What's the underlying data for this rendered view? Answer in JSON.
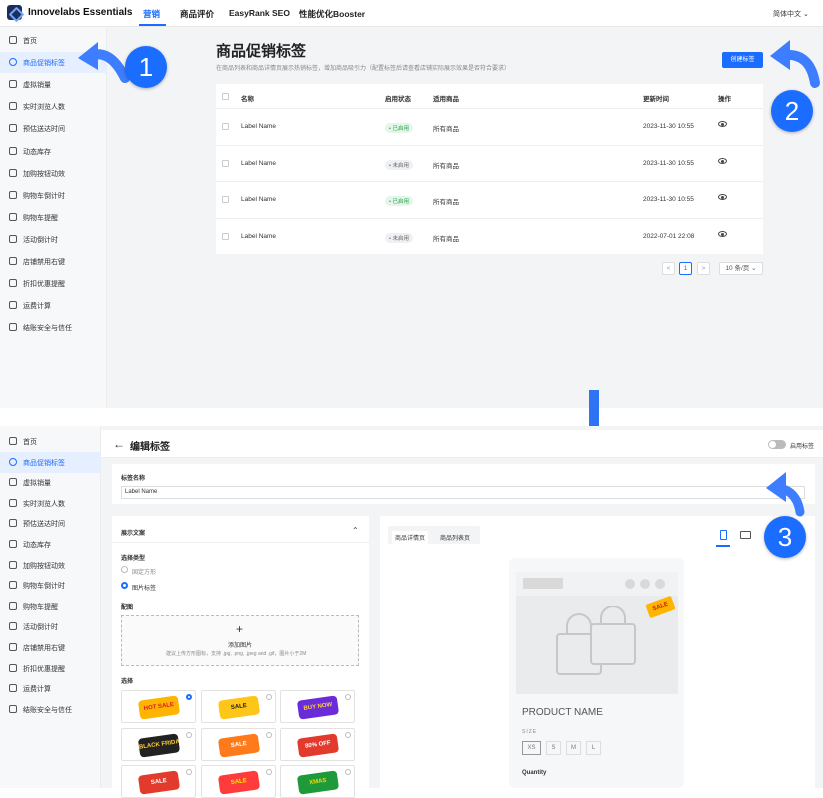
{
  "topbar": {
    "app_name": "Innovelabs Essentials",
    "nav": [
      "营销",
      "商品评价",
      "EasyRank SEO",
      "性能优化Booster"
    ],
    "language": "简体中文 ⌄"
  },
  "sidebar": {
    "items": [
      "首页",
      "商品促销标签",
      "虚拟销量",
      "实时浏览人数",
      "预估送达时间",
      "动态库存",
      "加购按钮动效",
      "购物车倒计时",
      "购物车提醒",
      "活动倒计时",
      "店铺禁用右键",
      "折扣优惠提醒",
      "运费计算",
      "结账安全与信任"
    ],
    "active_index": 1
  },
  "list_page": {
    "title": "商品促销标签",
    "description": "在商品列表和商品详情页展示热销标签，增加商品吸引力（配置标签后请查看店铺实际展示效果是否符合要求）",
    "create_button": "创建标签",
    "columns": [
      "名称",
      "启用状态",
      "适用商品",
      "更新时间",
      "操作"
    ],
    "rows": [
      {
        "name": "Label Name",
        "status": "• 已启用",
        "status_on": true,
        "scope": "所有商品",
        "updated": "2023-11-30 10:55"
      },
      {
        "name": "Label Name",
        "status": "• 未启用",
        "status_on": false,
        "scope": "所有商品",
        "updated": "2023-11-30 10:55"
      },
      {
        "name": "Label Name",
        "status": "• 已启用",
        "status_on": true,
        "scope": "所有商品",
        "updated": "2023-11-30 10:55"
      },
      {
        "name": "Label Name",
        "status": "• 未启用",
        "status_on": false,
        "scope": "所有商品",
        "updated": "2022-07-01 22:08"
      }
    ],
    "pagination": {
      "prev": "<",
      "page": "1",
      "next": ">",
      "page_size": "10 条/页 ⌄"
    }
  },
  "callouts": [
    "1",
    "2",
    "3"
  ],
  "edit_page": {
    "title": "编辑标签",
    "back": "←",
    "toggle_label": "启用标签",
    "label_name_title": "标签名称",
    "label_name_value": "Label Name",
    "section_title": "展示文案",
    "type_title": "选择类型",
    "type_options": [
      "固定方形",
      "图片标签"
    ],
    "type_selected_index": 1,
    "image_title": "配图",
    "upload_plus": "+",
    "upload_text": "添加图片",
    "upload_hint": "建议上传方形图标，支持 .jpg, .png, .jpeg and .gif，图片小于2M",
    "choose_title": "选择",
    "stickers": [
      "HOT SALE",
      "SALE",
      "BUY NOW",
      "BLACK FRIDAY",
      "SALE",
      "80% OFF",
      "SALE",
      "SALE",
      "XMAS"
    ],
    "preview_tabs": [
      "商品详情页",
      "商品列表页"
    ],
    "product_name": "PRODUCT NAME",
    "size_label": "SIZE",
    "sizes": [
      "XS",
      "S",
      "M",
      "L"
    ],
    "quantity_label": "Quantity",
    "preview_badge": "SALE"
  },
  "colors": {
    "accent": "#1a6dff",
    "sidebar_bg": "#f7f8fa",
    "page_bg": "#f3f4f6"
  }
}
